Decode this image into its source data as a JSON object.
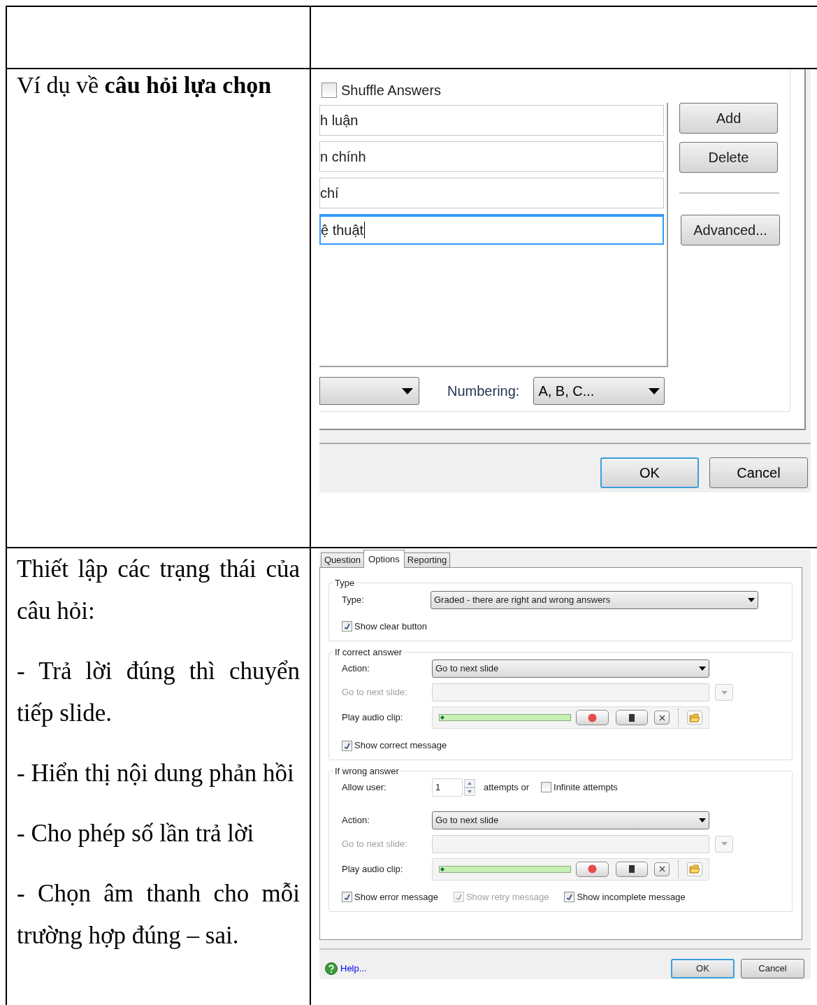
{
  "example_row": {
    "caption": "Ví dụ về **câu hỏi lựa chọn**"
  },
  "answers_dialog": {
    "shuffle": {
      "label": "Shuffle Answers",
      "checked": false
    },
    "answers": [
      {
        "value": "h luận",
        "focused": false
      },
      {
        "value": "n chính",
        "focused": false
      },
      {
        "value": "chí",
        "focused": false
      },
      {
        "value": "ệ thuật",
        "focused": true
      }
    ],
    "side_buttons": [
      "Add",
      "Delete",
      "Advanced..."
    ],
    "numbering_label": "Numbering:",
    "numbering_value": "A, B, C...",
    "footer_buttons": [
      {
        "label": "OK",
        "default": true
      },
      {
        "label": "Cancel",
        "default": false
      }
    ]
  },
  "settings_row": {
    "paragraphs": [
      "Thiết lập các trạng thái của câu hỏi:",
      "- Trả lời đúng thì chuyển tiếp slide.",
      "- Hiển thị nội dung phản hồi",
      "- Cho phép số lần trả lời",
      "- Chọn âm thanh cho mỗi trường hợp đúng – sai."
    ]
  },
  "options_dialog": {
    "tabs": [
      {
        "label": "Question",
        "selected": false
      },
      {
        "label": "Options",
        "selected": true
      },
      {
        "label": "Reporting",
        "selected": false
      }
    ],
    "groups": [
      {
        "title": "Type",
        "rows": [
          {
            "kind": "dropdown",
            "label": "Type:",
            "value": "Graded - there are right and wrong answers",
            "wide": true
          },
          {
            "kind": "checks",
            "items": [
              {
                "label": "Show clear button",
                "checked": true,
                "disabled": false
              }
            ]
          }
        ]
      },
      {
        "title": "If correct answer",
        "rows": [
          {
            "kind": "dropdown",
            "label": "Action:",
            "value": "Go to next slide",
            "wide": false
          },
          {
            "kind": "disabled_dropdown",
            "label": "Go to next slide:"
          },
          {
            "kind": "audio",
            "label": "Play audio clip:"
          },
          {
            "kind": "checks",
            "items": [
              {
                "label": "Show correct message",
                "checked": true,
                "disabled": false
              }
            ]
          }
        ]
      },
      {
        "title": "If wrong answer",
        "rows": [
          {
            "kind": "spinner",
            "label": "Allow user:",
            "value": "1",
            "suffix": "attempts or",
            "check": {
              "label": "Infinite attempts",
              "checked": false
            }
          },
          {
            "kind": "dropdown",
            "label": "Action:",
            "value": "Go to next slide",
            "wide": false
          },
          {
            "kind": "disabled_dropdown",
            "label": "Go to next slide:"
          },
          {
            "kind": "audio",
            "label": "Play audio clip:"
          },
          {
            "kind": "checks",
            "items": [
              {
                "label": "Show error message",
                "checked": true,
                "disabled": false
              },
              {
                "label": "Show retry message",
                "checked": true,
                "disabled": true
              },
              {
                "label": "Show incomplete message",
                "checked": true,
                "disabled": false
              }
            ]
          }
        ]
      }
    ],
    "help": "Help...",
    "footer_buttons": [
      {
        "label": "OK",
        "default": true
      },
      {
        "label": "Cancel",
        "default": false
      }
    ]
  }
}
